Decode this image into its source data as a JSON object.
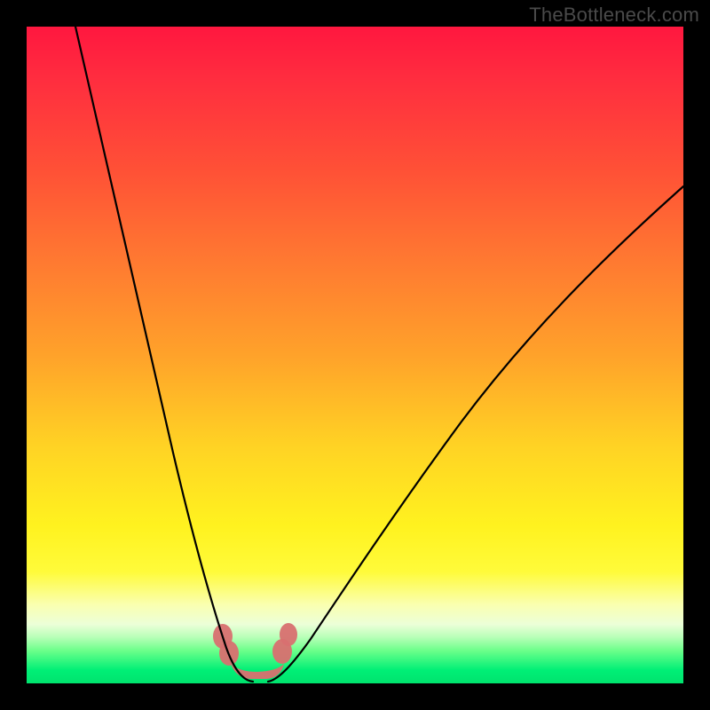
{
  "watermark": "TheBottleneck.com",
  "chart_data": {
    "type": "line",
    "title": "",
    "xlabel": "",
    "ylabel": "",
    "xlim": [
      0,
      100
    ],
    "ylim": [
      0,
      100
    ],
    "background_gradient": [
      "#ff173f",
      "#ff7a31",
      "#ffd324",
      "#fffb3a",
      "#00e36e"
    ],
    "series": [
      {
        "name": "curve-left",
        "x": [
          7.5,
          9,
          11,
          13,
          15,
          17,
          19,
          21,
          23,
          25,
          27,
          29,
          30,
          31,
          32,
          33,
          34
        ],
        "values": [
          100,
          94,
          86,
          78,
          70,
          62,
          54,
          46,
          38,
          30,
          22,
          14,
          9,
          5,
          2,
          0.7,
          0
        ]
      },
      {
        "name": "curve-right",
        "x": [
          38,
          40,
          43,
          47,
          52,
          58,
          64,
          70,
          76,
          82,
          88,
          94,
          100
        ],
        "values": [
          0,
          2,
          6,
          12,
          20,
          29,
          37,
          45,
          52,
          59,
          65,
          71,
          76
        ]
      }
    ],
    "markers": {
      "left_band": {
        "x": [
          29.5,
          31.5
        ],
        "y_range": [
          2,
          10
        ]
      },
      "right_band": {
        "x": [
          38.5,
          41.0
        ],
        "y_range": [
          2,
          10
        ]
      },
      "valley": {
        "x": [
          31.5,
          38.5
        ],
        "y_range": [
          0,
          3
        ]
      }
    }
  }
}
